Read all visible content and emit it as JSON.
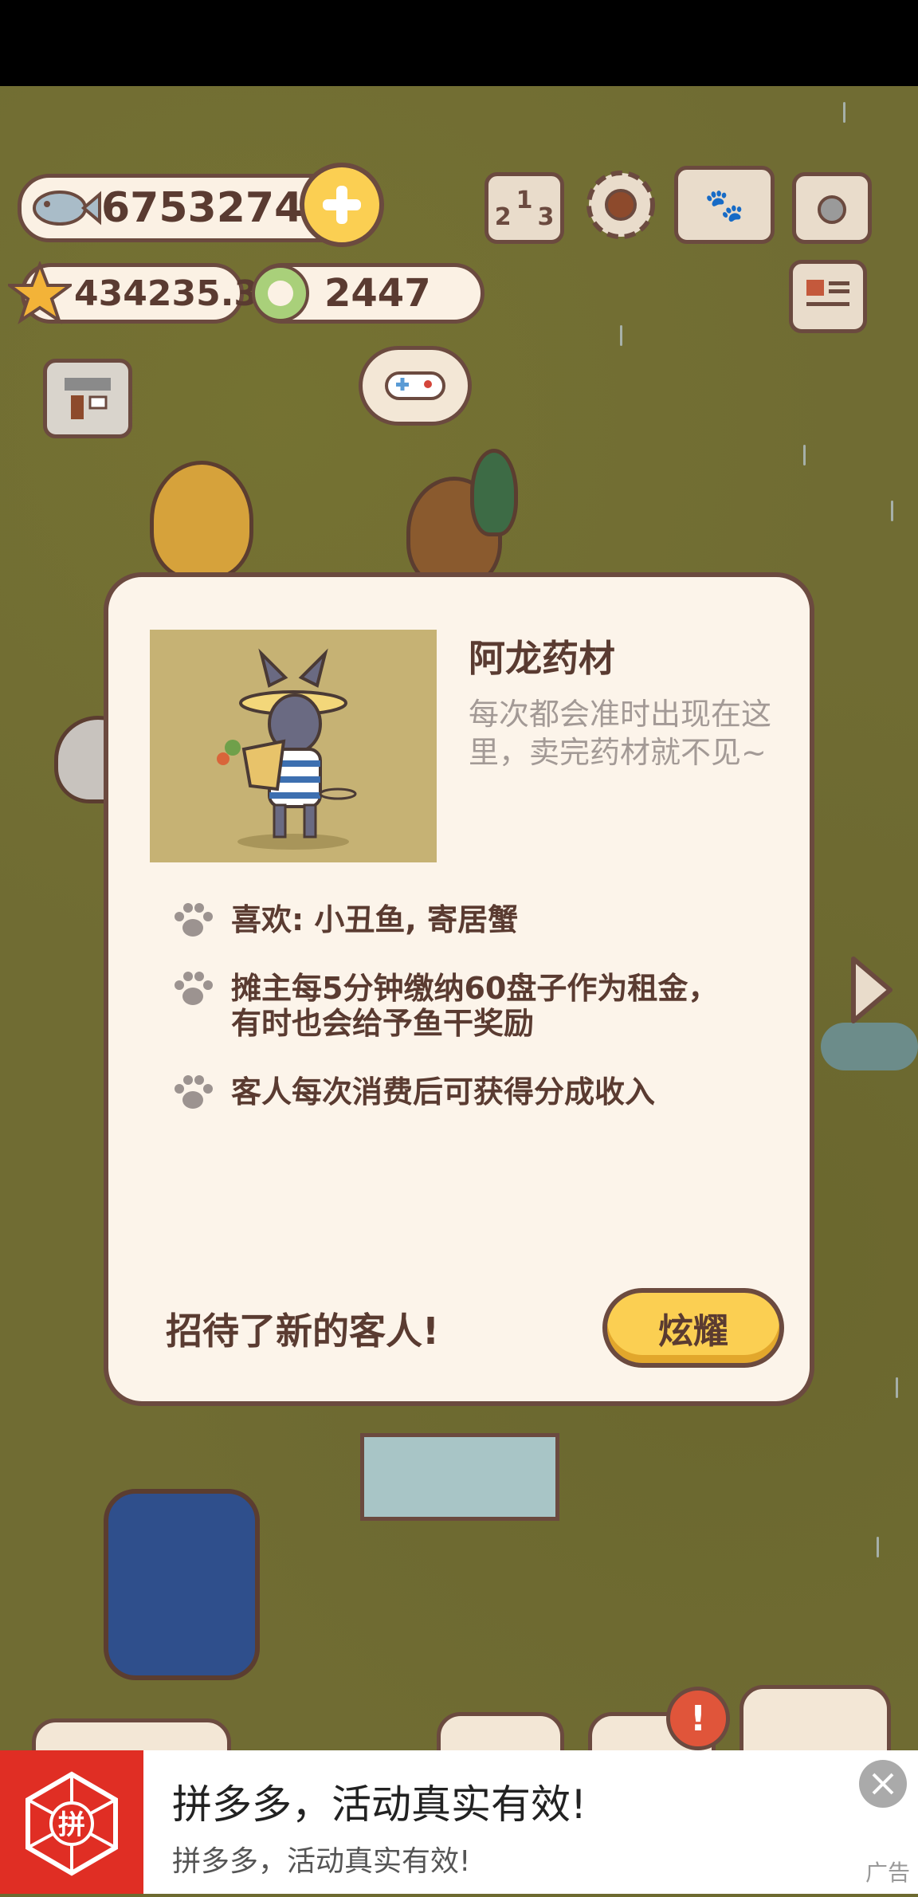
{
  "hud": {
    "fish_count": "67532740",
    "star_count": "434235.3",
    "coin_count": "2447"
  },
  "icons": {
    "fish": "fish-icon",
    "plus": "plus-icon",
    "star": "star-icon",
    "coin": "coin-icon",
    "leaderboard": "leaderboard-icon",
    "settings": "gear-icon",
    "book": "paw-book-icon",
    "camera": "camera-icon",
    "newspaper": "newspaper-icon",
    "shop": "shop-icon",
    "game": "gamepad-icon",
    "arrow": "chevron-right-icon"
  },
  "leaderboard_digits": [
    "2",
    "1",
    "3"
  ],
  "dialog": {
    "name": "阿龙药材",
    "description": "每次都会准时出现在这里，卖完药材就不见~",
    "bullets": [
      "喜欢: 小丑鱼, 寄居蟹",
      "摊主每5分钟缴纳60盘子作为租金，\n有时也会给予鱼干奖励",
      "客人每次消费后可获得分成收入"
    ],
    "footer": "招待了新的客人!",
    "show_off_button": "炫耀"
  },
  "ad": {
    "logo_text": "拼",
    "title": "拼多多，活动真实有效!",
    "subtitle": "拼多多，活动真实有效!",
    "label": "广告"
  },
  "colors": {
    "accent_yellow": "#fbcf52",
    "outline_brown": "#6b4a3f",
    "text_brown": "#5a3b31",
    "dialog_bg": "#fcf4ea",
    "ad_red": "#e02e24"
  }
}
